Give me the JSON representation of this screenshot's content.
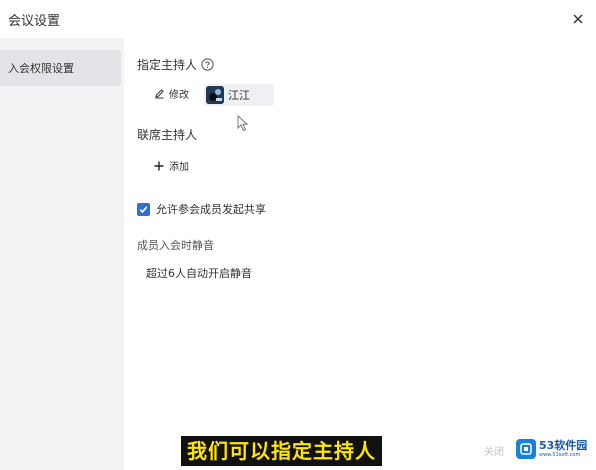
{
  "window": {
    "title": "会议设置"
  },
  "sidebar": {
    "items": [
      {
        "label": "入会权限设置"
      }
    ]
  },
  "main": {
    "designated_host": {
      "title": "指定主持人",
      "edit_label": "修改",
      "host_name": "江江"
    },
    "co_host": {
      "title": "联席主持人",
      "add_label": "添加"
    },
    "allow_share": {
      "label": "允许参会成员发起共享",
      "checked": true
    },
    "mute_on_join": {
      "title": "成员入会时静音",
      "value": "超过6人自动开启静音"
    }
  },
  "footer": {
    "close_label": "关闭"
  },
  "overlay": {
    "subtitle": "我们可以指定主持人",
    "watermark_name": "53软件园",
    "watermark_url": "www.53soft.com"
  },
  "colors": {
    "accent": "#2f6fd6",
    "sidebar_bg": "#f2f3f5",
    "sidebar_active": "#e3e4e7",
    "subtitle_text": "#ffe600",
    "subtitle_bg": "#111111"
  }
}
